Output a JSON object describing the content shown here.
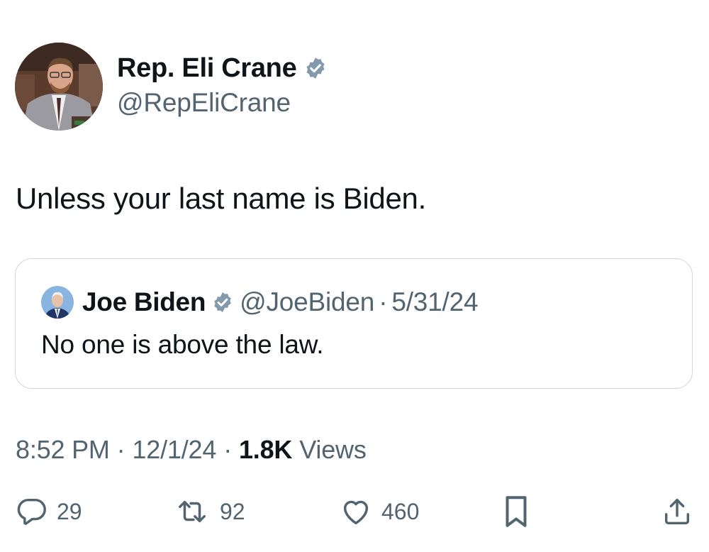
{
  "author": {
    "name": "Rep. Eli Crane",
    "handle": "@RepEliCrane",
    "verified_color": "#829aab",
    "avatar_icon": "profile-photo"
  },
  "tweet": {
    "text": "Unless your last name is Biden."
  },
  "quoted": {
    "name": "Joe Biden",
    "handle": "@JoeBiden",
    "separator": "·",
    "date": "5/31/24",
    "text": "No one is above the law.",
    "avatar_icon": "profile-photo"
  },
  "meta": {
    "time": "8:52 PM",
    "separator": "·",
    "date": "12/1/24",
    "views_count": "1.8K",
    "views_label": "Views"
  },
  "actions": {
    "replies": "29",
    "reposts": "92",
    "likes": "460",
    "icons": [
      "reply-icon",
      "repost-icon",
      "like-icon",
      "bookmark-icon",
      "share-icon"
    ]
  },
  "colors": {
    "text": "#0f1419",
    "secondary": "#536471",
    "border": "#cfd9de",
    "icon": "#536471"
  }
}
